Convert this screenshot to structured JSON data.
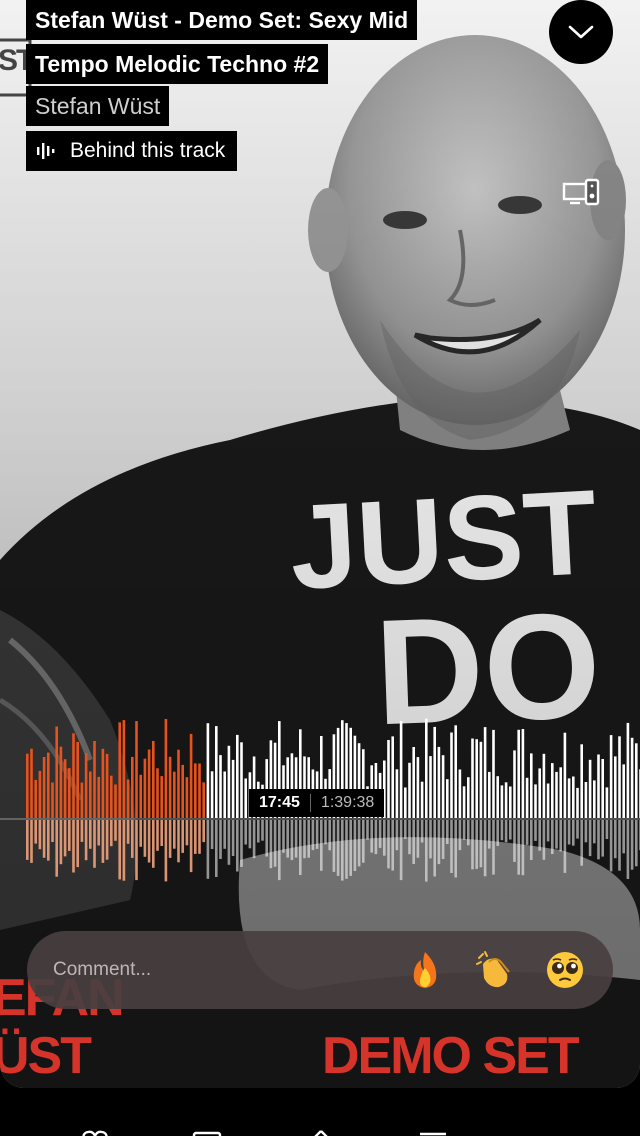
{
  "track": {
    "title_line1": "Stefan Wüst  -  Demo Set: Sexy Mid",
    "title_line2": "Tempo  Melodic Techno #2",
    "artist": "Stefan Wüst",
    "behind_label": "Behind this track"
  },
  "artwork": {
    "shirt_text": "JUST DO IT",
    "logo_partial": "ST",
    "poster_left_line1": "EFAN",
    "poster_left_line2": "ÜST",
    "poster_right": "DEMO SET"
  },
  "player": {
    "current_time": "17:45",
    "duration": "1:39:38",
    "progress": 0.178
  },
  "comment": {
    "placeholder": "Comment...",
    "reactions": [
      "fire-emoji",
      "clapping-hands-emoji",
      "pleading-face-emoji"
    ]
  },
  "colors": {
    "played": "#e8521c",
    "played_reflection": "#f1a27c",
    "unplayed": "#ffffff",
    "comment_bg": "#484040"
  },
  "icons": {
    "collapse": "chevron-down-icon",
    "behind": "waveform-icon",
    "cast": "devices-icon",
    "nav": [
      "heart-icon",
      "comment-icon",
      "share-icon",
      "queue-icon"
    ]
  }
}
